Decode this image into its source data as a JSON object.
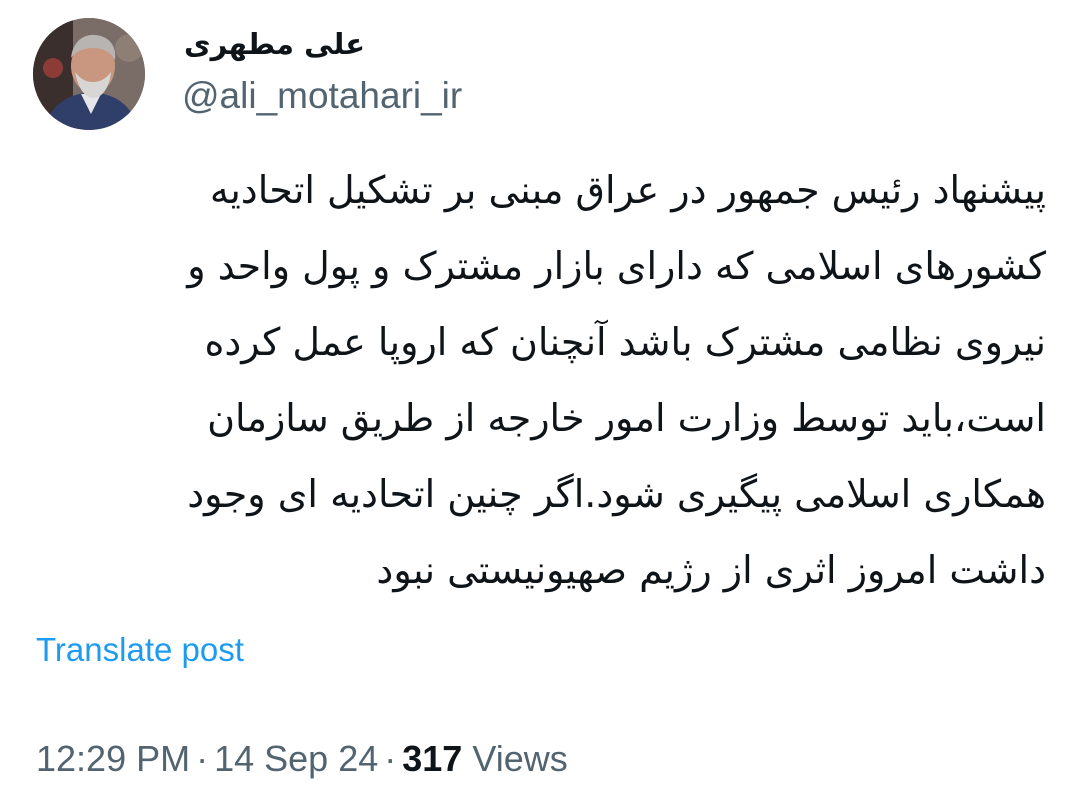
{
  "author": {
    "display_name": "علی مطهری",
    "handle": "@ali_motahari_ir"
  },
  "post": {
    "lines": [
      "پیشنهاد رئیس جمهور در عراق مبنی بر تشکیل اتحادیه",
      "کشورهای اسلامی که دارای بازار مشترک و پول واحد و",
      "نیروی نظامی مشترک باشد آنچنان که اروپا عمل کرده",
      "است،باید توسط وزارت امور خارجه از طریق سازمان",
      "همکاری اسلامی پیگیری شود.اگر چنین اتحادیه ای وجود",
      "داشت امروز اثری از رژیم صهیونیستی نبود"
    ],
    "translate_label": "Translate post"
  },
  "meta": {
    "time": "12:29 PM",
    "separator": "·",
    "date": "14 Sep 24",
    "views_count": "317",
    "views_label": "Views"
  },
  "colors": {
    "text": "#0f1419",
    "secondary": "#536471",
    "accent": "#1d9bf0"
  }
}
